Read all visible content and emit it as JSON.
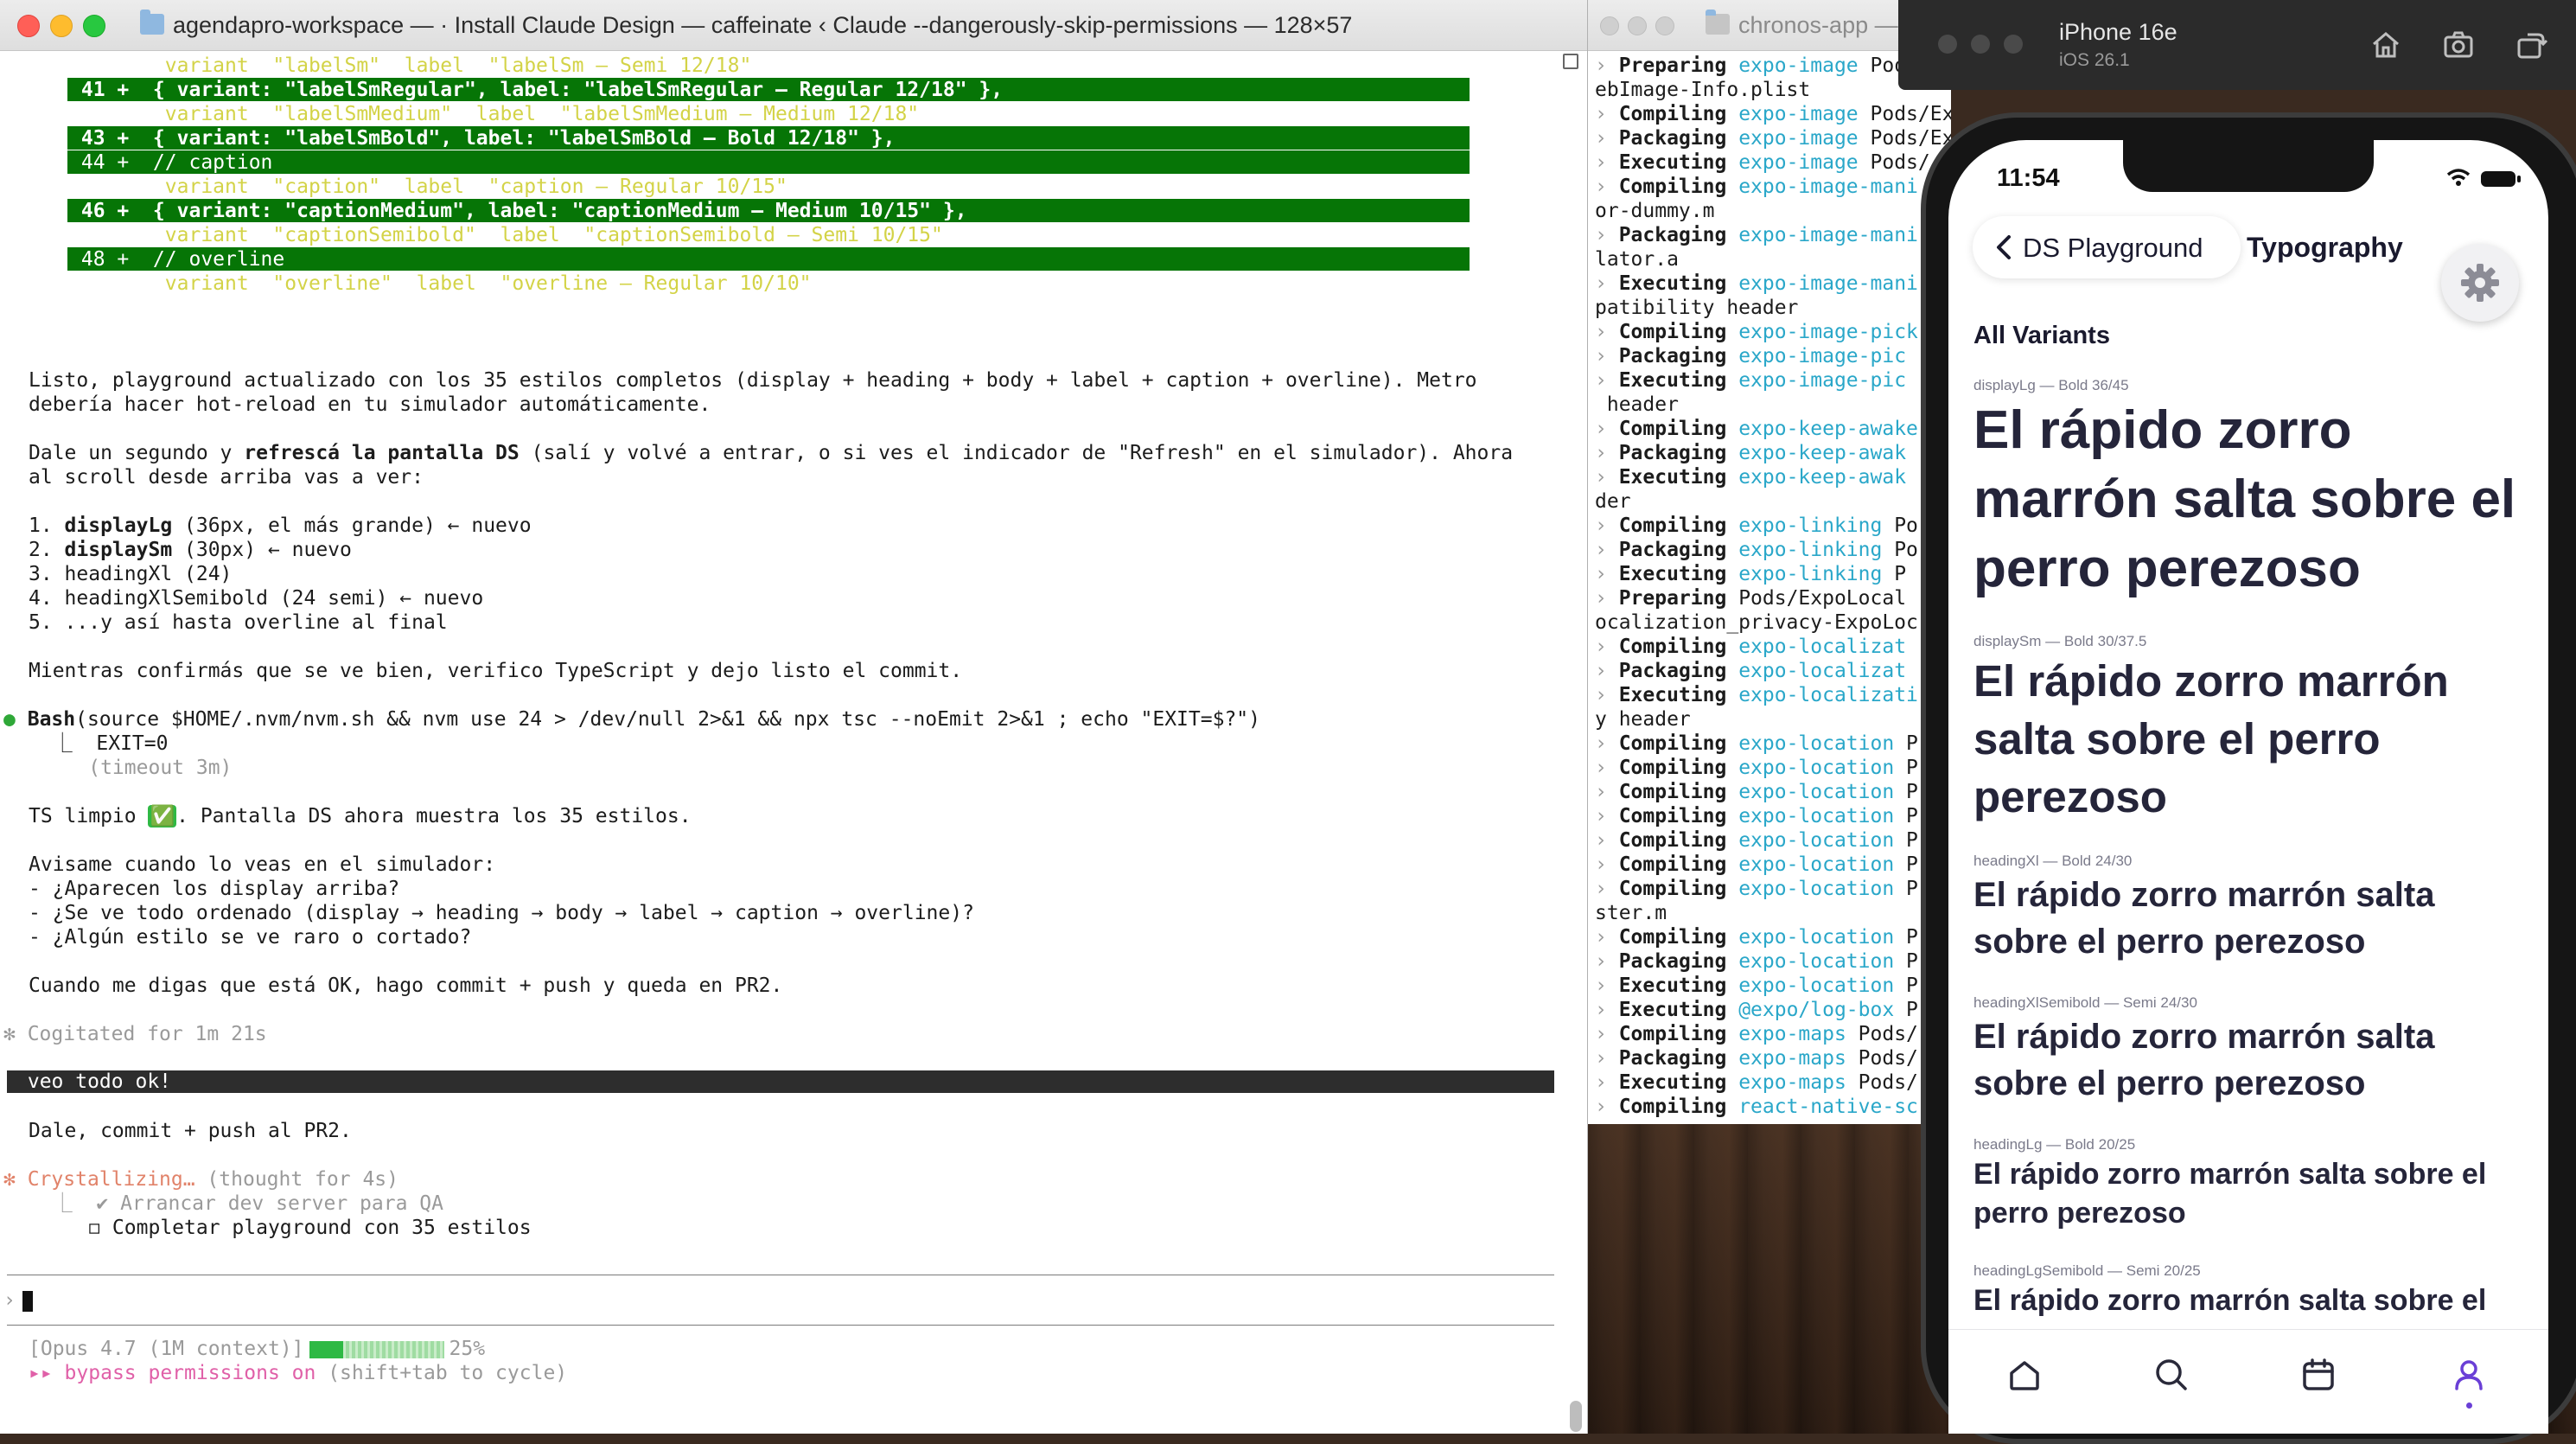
{
  "left_terminal": {
    "title": "agendapro-workspace —  · Install Claude Design — caffeinate ‹ Claude --dangerously-skip-permissions — 128×57",
    "diff_lines": [
      {
        "kind": "ctx",
        "text": "        variant  \"labelSm\"  label  \"labelSm — Semi 12/18\""
      },
      {
        "kind": "add",
        "text": " 41 +  { variant: \"labelSmRegular\", label: \"labelSmRegular — Regular 12/18\" },"
      },
      {
        "kind": "ctx",
        "text": "        variant  \"labelSmMedium\"  label  \"labelSmMedium — Medium 12/18\""
      },
      {
        "kind": "add",
        "text": " 43 +  { variant: \"labelSmBold\", label: \"labelSmBold — Bold 12/18\" },"
      },
      {
        "kind": "add",
        "text": " 44 +  // caption"
      },
      {
        "kind": "ctx",
        "text": "        variant  \"caption\"  label  \"caption — Regular 10/15\""
      },
      {
        "kind": "add",
        "text": " 46 +  { variant: \"captionMedium\", label: \"captionMedium — Medium 10/15\" },"
      },
      {
        "kind": "ctx",
        "text": "        variant  \"captionSemibold\"  label  \"captionSemibold — Semi 10/15\""
      },
      {
        "kind": "add",
        "text": " 48 +  // overline"
      },
      {
        "kind": "ctx",
        "text": "        variant  \"overline\"  label  \"overline — Regular 10/10\""
      }
    ],
    "para1_line1": "Listo, playground actualizado con los 35 estilos completos (display + heading + body + label + caption + overline). Metro",
    "para1_line2": "debería hacer hot-reload en tu simulador automáticamente.",
    "para2_a": "Dale un segundo y ",
    "para2_b": "refrescá la pantalla DS",
    "para2_c": " (salí y volvé a entrar, o si ves el indicador de \"Refresh\" en el simulador). Ahora",
    "para2_line2": "al scroll desde arriba vas a ver:",
    "list": [
      {
        "num": "1. ",
        "bold": "displayLg",
        "rest": " (36px, el más grande) ← nuevo"
      },
      {
        "num": "2. ",
        "bold": "displaySm",
        "rest": " (30px) ← nuevo"
      },
      {
        "num": "3. ",
        "bold": "",
        "rest": "headingXl (24)"
      },
      {
        "num": "4. ",
        "bold": "",
        "rest": "headingXlSemibold (24 semi) ← nuevo"
      },
      {
        "num": "5. ",
        "bold": "",
        "rest": "...y así hasta overline al final"
      }
    ],
    "para3": "Mientras confirmás que se ve bien, verifico TypeScript y dejo listo el commit.",
    "bash_dot": "●",
    "bash_label": "Bash",
    "bash_cmd": "(source $HOME/.nvm/nvm.sh && nvm use 24 > /dev/null 2>&1 && npx tsc --noEmit 2>&1 ; echo \"EXIT=$?\")",
    "bash_out1": "  ⎿  EXIT=0",
    "bash_out2": "     (timeout 3m)",
    "ts_a": "TS limpio ",
    "ts_check": "✅",
    "ts_b": ". Pantalla DS ahora muestra los 35 estilos.",
    "ask_lines": [
      "Avisame cuando lo veas en el simulador:",
      "- ¿Aparecen los display arriba?",
      "- ¿Se ve todo ordenado (display → heading → body → label → caption → overline)?",
      "- ¿Algún estilo se ve raro o cortado?"
    ],
    "para5": "Cuando me digas que está OK, hago commit + push y queda en PR2.",
    "cogitated": "✻ Cogitated for 1m 21s",
    "user_msg": " veo todo ok!",
    "reply": "Dale, commit + push al PR2.",
    "crystal_star": "✻",
    "crystal_word": " Crystallizing…",
    "crystal_rest": " (thought for 4s)",
    "todo_done": "  ⎿  ✔ Arrancar dev server para QA",
    "todo_open": "     ◻ Completar playground con 35 estilos",
    "prompt_symbol": "›",
    "status_model": "[Opus 4.7 (1M context)]",
    "status_percent": "25%",
    "context_progress": 0.25,
    "bypass_arrows": "▸▸",
    "bypass_text": " bypass permissions on",
    "bypass_hint": " (shift+tab to cycle)"
  },
  "right_terminal": {
    "title": "chronos-app —",
    "lines": [
      {
        "chev": "› ",
        "verb": "Preparing",
        "pkg": "expo-image",
        "rest": " Poo"
      },
      {
        "chev": "",
        "verb": "",
        "pkg": "",
        "rest": "ebImage-Info.plist"
      },
      {
        "chev": "› ",
        "verb": "Compiling",
        "pkg": "expo-image",
        "rest": " Pods/ExpoImage"
      },
      {
        "chev": "› ",
        "verb": "Packaging",
        "pkg": "expo-image",
        "rest": " Pods/Ex"
      },
      {
        "chev": "› ",
        "verb": "Executing",
        "pkg": "expo-image",
        "rest": " Pods/"
      },
      {
        "chev": "› ",
        "verb": "Compiling",
        "pkg": "expo-image-mani",
        "rest": ""
      },
      {
        "chev": "",
        "verb": "",
        "pkg": "",
        "rest": "or-dummy.m"
      },
      {
        "chev": "› ",
        "verb": "Packaging",
        "pkg": "expo-image-mani",
        "rest": ""
      },
      {
        "chev": "",
        "verb": "",
        "pkg": "",
        "rest": "lator.a"
      },
      {
        "chev": "› ",
        "verb": "Executing",
        "pkg": "expo-image-mani",
        "rest": ""
      },
      {
        "chev": "",
        "verb": "",
        "pkg": "",
        "rest": "patibility header"
      },
      {
        "chev": "› ",
        "verb": "Compiling",
        "pkg": "expo-image-pick",
        "rest": ""
      },
      {
        "chev": "› ",
        "verb": "Packaging",
        "pkg": "expo-image-pic",
        "rest": ""
      },
      {
        "chev": "› ",
        "verb": "Executing",
        "pkg": "expo-image-pic",
        "rest": ""
      },
      {
        "chev": "",
        "verb": "",
        "pkg": "",
        "rest": " header"
      },
      {
        "chev": "› ",
        "verb": "Compiling",
        "pkg": "expo-keep-awake",
        "rest": ""
      },
      {
        "chev": "› ",
        "verb": "Packaging",
        "pkg": "expo-keep-awak",
        "rest": ""
      },
      {
        "chev": "› ",
        "verb": "Executing",
        "pkg": "expo-keep-awak",
        "rest": ""
      },
      {
        "chev": "",
        "verb": "",
        "pkg": "",
        "rest": "der"
      },
      {
        "chev": "› ",
        "verb": "Compiling",
        "pkg": "expo-linking",
        "rest": " Po"
      },
      {
        "chev": "› ",
        "verb": "Packaging",
        "pkg": "expo-linking",
        "rest": " Po"
      },
      {
        "chev": "› ",
        "verb": "Executing",
        "pkg": "expo-linking",
        "rest": " P"
      },
      {
        "chev": "› ",
        "verb": "Preparing",
        "pkg": "",
        "rest": "Pods/ExpoLocal"
      },
      {
        "chev": "",
        "verb": "",
        "pkg": "",
        "rest": "ocalization_privacy-ExpoLoc"
      },
      {
        "chev": "› ",
        "verb": "Compiling",
        "pkg": "expo-localizat",
        "rest": ""
      },
      {
        "chev": "› ",
        "verb": "Packaging",
        "pkg": "expo-localizat",
        "rest": ""
      },
      {
        "chev": "› ",
        "verb": "Executing",
        "pkg": "expo-localizati",
        "rest": ""
      },
      {
        "chev": "",
        "verb": "",
        "pkg": "",
        "rest": "y header"
      },
      {
        "chev": "› ",
        "verb": "Compiling",
        "pkg": "expo-location",
        "rest": " P"
      },
      {
        "chev": "› ",
        "verb": "Compiling",
        "pkg": "expo-location",
        "rest": " P"
      },
      {
        "chev": "› ",
        "verb": "Compiling",
        "pkg": "expo-location",
        "rest": " P"
      },
      {
        "chev": "› ",
        "verb": "Compiling",
        "pkg": "expo-location",
        "rest": " P"
      },
      {
        "chev": "› ",
        "verb": "Compiling",
        "pkg": "expo-location",
        "rest": " P"
      },
      {
        "chev": "› ",
        "verb": "Compiling",
        "pkg": "expo-location",
        "rest": " P"
      },
      {
        "chev": "› ",
        "verb": "Compiling",
        "pkg": "expo-location",
        "rest": " P"
      },
      {
        "chev": "",
        "verb": "",
        "pkg": "",
        "rest": "ster.m"
      },
      {
        "chev": "› ",
        "verb": "Compiling",
        "pkg": "expo-location",
        "rest": " P"
      },
      {
        "chev": "› ",
        "verb": "Packaging",
        "pkg": "expo-location",
        "rest": " P"
      },
      {
        "chev": "› ",
        "verb": "Executing",
        "pkg": "expo-location",
        "rest": " P"
      },
      {
        "chev": "› ",
        "verb": "Executing",
        "pkg": "@expo/log-box",
        "rest": " P"
      },
      {
        "chev": "› ",
        "verb": "Compiling",
        "pkg": "expo-maps",
        "rest": " Pods/"
      },
      {
        "chev": "› ",
        "verb": "Packaging",
        "pkg": "expo-maps",
        "rest": " Pods/"
      },
      {
        "chev": "› ",
        "verb": "Executing",
        "pkg": "expo-maps",
        "rest": " Pods/"
      },
      {
        "chev": "› ",
        "verb": "Compiling",
        "pkg": "react-native-sc",
        "rest": ""
      }
    ]
  },
  "simulator": {
    "device": "iPhone 16e",
    "os": "iOS 26.1",
    "tools": [
      "home-icon",
      "screenshot-icon",
      "rotate-icon"
    ]
  },
  "phone": {
    "time": "11:54",
    "back_label": "DS Playground",
    "nav_title": "Typography",
    "section_title": "All Variants",
    "variants": [
      {
        "caption": "displayLg — Bold 36/45",
        "sample": "El rápido zorro marrón salta sobre el perro perezoso"
      },
      {
        "caption": "displaySm — Bold 30/37.5",
        "sample": "El rápido zorro marrón salta sobre el perro perezoso"
      },
      {
        "caption": "headingXl — Bold 24/30",
        "sample": "El rápido zorro marrón salta sobre el perro perezoso"
      },
      {
        "caption": "headingXlSemibold — Semi 24/30",
        "sample": "El rápido zorro marrón salta sobre el perro perezoso"
      },
      {
        "caption": "headingLg — Bold 20/25",
        "sample": "El rápido zorro marrón salta sobre el perro perezoso"
      },
      {
        "caption": "headingLgSemibold — Semi 20/25",
        "sample": "El rápido zorro marrón salta sobre el"
      }
    ],
    "tabs": [
      "home-tab-icon",
      "search-tab-icon",
      "calendar-tab-icon",
      "profile-tab-icon"
    ],
    "accent_color": "#6a3fd6"
  }
}
